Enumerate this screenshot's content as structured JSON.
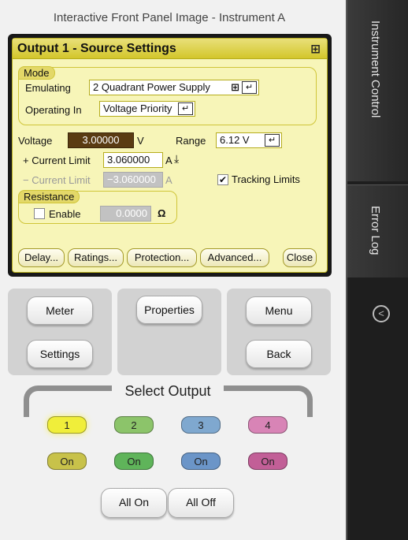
{
  "window_title": "Interactive Front Panel Image - Instrument A",
  "settings": {
    "title": "Output 1 - Source Settings",
    "pin_icon": "⊞",
    "mode_label": "Mode",
    "emulating_label": "Emulating",
    "emulating_value": "2 Quadrant Power Supply",
    "operating_label": "Operating In",
    "operating_value": "Voltage Priority",
    "voltage_label": "Voltage",
    "voltage_value": "3.00000",
    "voltage_unit": "V",
    "range_label": "Range",
    "range_value": "6.12 V",
    "plus_current_label": "+ Current Limit",
    "plus_current_value": "3.060000",
    "plus_current_unit": "A",
    "minus_current_label": "− Current Limit",
    "minus_current_value": "−3.060000",
    "minus_current_unit": "A",
    "tracking_label": "Tracking Limits",
    "tracking_checked": true,
    "resistance_label": "Resistance",
    "enable_label": "Enable",
    "resistance_value": "0.0000",
    "resistance_unit": "Ω",
    "buttons": [
      "Delay...",
      "Ratings...",
      "Protection...",
      "Advanced...",
      "Close"
    ]
  },
  "controls": {
    "meter": "Meter",
    "settings": "Settings",
    "properties": "Properties",
    "menu": "Menu",
    "back": "Back"
  },
  "select_output": {
    "label": "Select Output",
    "outputs": [
      {
        "label": "1",
        "color": "#f0ee3a",
        "on_label": "On",
        "on_color": "#c8c24a"
      },
      {
        "label": "2",
        "color": "#8cc46a",
        "on_label": "On",
        "on_color": "#5fb45a"
      },
      {
        "label": "3",
        "color": "#7fa8cf",
        "on_label": "On",
        "on_color": "#6b95c8"
      },
      {
        "label": "4",
        "color": "#d884b6",
        "on_label": "On",
        "on_color": "#c25f97"
      }
    ],
    "all_on": "All On",
    "all_off": "All Off"
  },
  "sidebar": {
    "tabs": [
      "Instrument Control",
      "Error Log"
    ],
    "collapse_icon": "chevron-left-icon"
  }
}
